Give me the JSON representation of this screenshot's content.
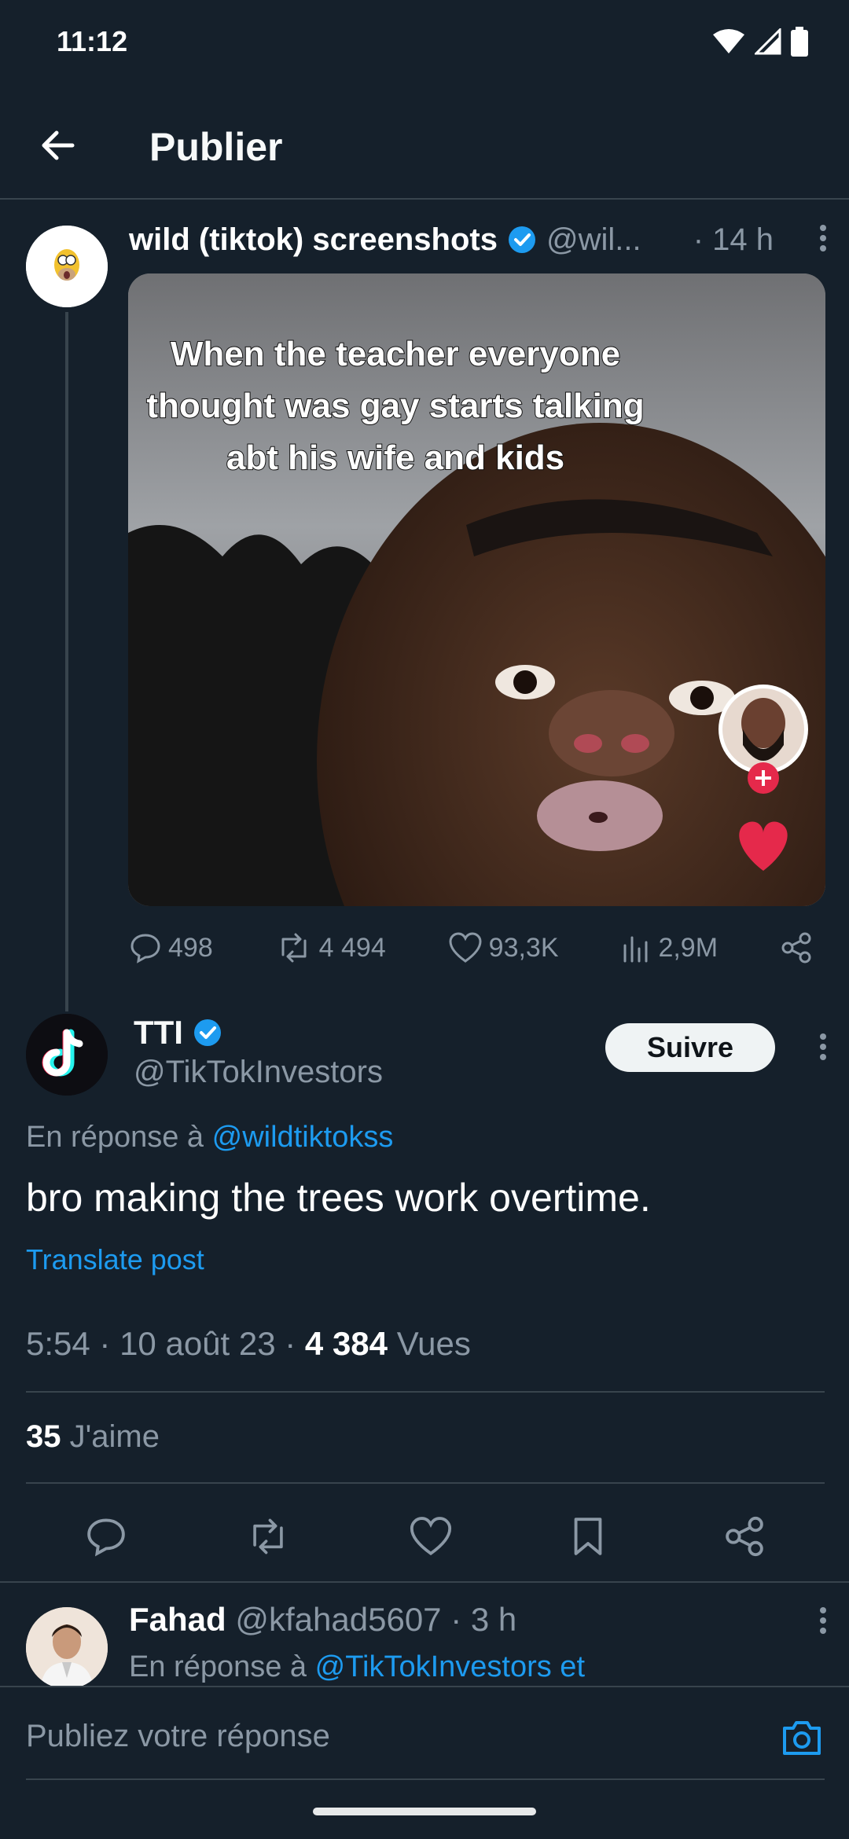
{
  "status_bar": {
    "time": "11:12"
  },
  "header": {
    "title": "Publier"
  },
  "parent_tweet": {
    "name": "wild (tiktok) screenshots",
    "handle": "@wil...",
    "time": "· 14 h",
    "media_caption": "When the teacher everyone thought was gay starts talking abt his wife and kids",
    "stats": {
      "replies": "498",
      "reposts": "4 494",
      "likes": "93,3K",
      "views": "2,9M"
    }
  },
  "main_tweet": {
    "name": "TTI",
    "handle": "@TikTokInvestors",
    "follow_label": "Suivre",
    "reply_prefix": "En réponse à",
    "reply_to": "@wildtiktokss",
    "text": "bro making the trees work overtime.",
    "translate": "Translate post",
    "timestamp": "5:54 · 10 août 23 ·",
    "views_count": "4 384",
    "views_label": "Vues",
    "likes_count": "35",
    "likes_label": "J'aime"
  },
  "reply": {
    "name": "Fahad",
    "handle": "@kfahad5607",
    "time": "· 3 h",
    "prefix": "En réponse à",
    "to": "@TikTokInvestors et"
  },
  "composer": {
    "placeholder": "Publiez votre réponse"
  },
  "colors": {
    "background": "#15202b",
    "accent": "#1d9bf0",
    "muted": "#8b98a5",
    "divider": "#38444d"
  }
}
